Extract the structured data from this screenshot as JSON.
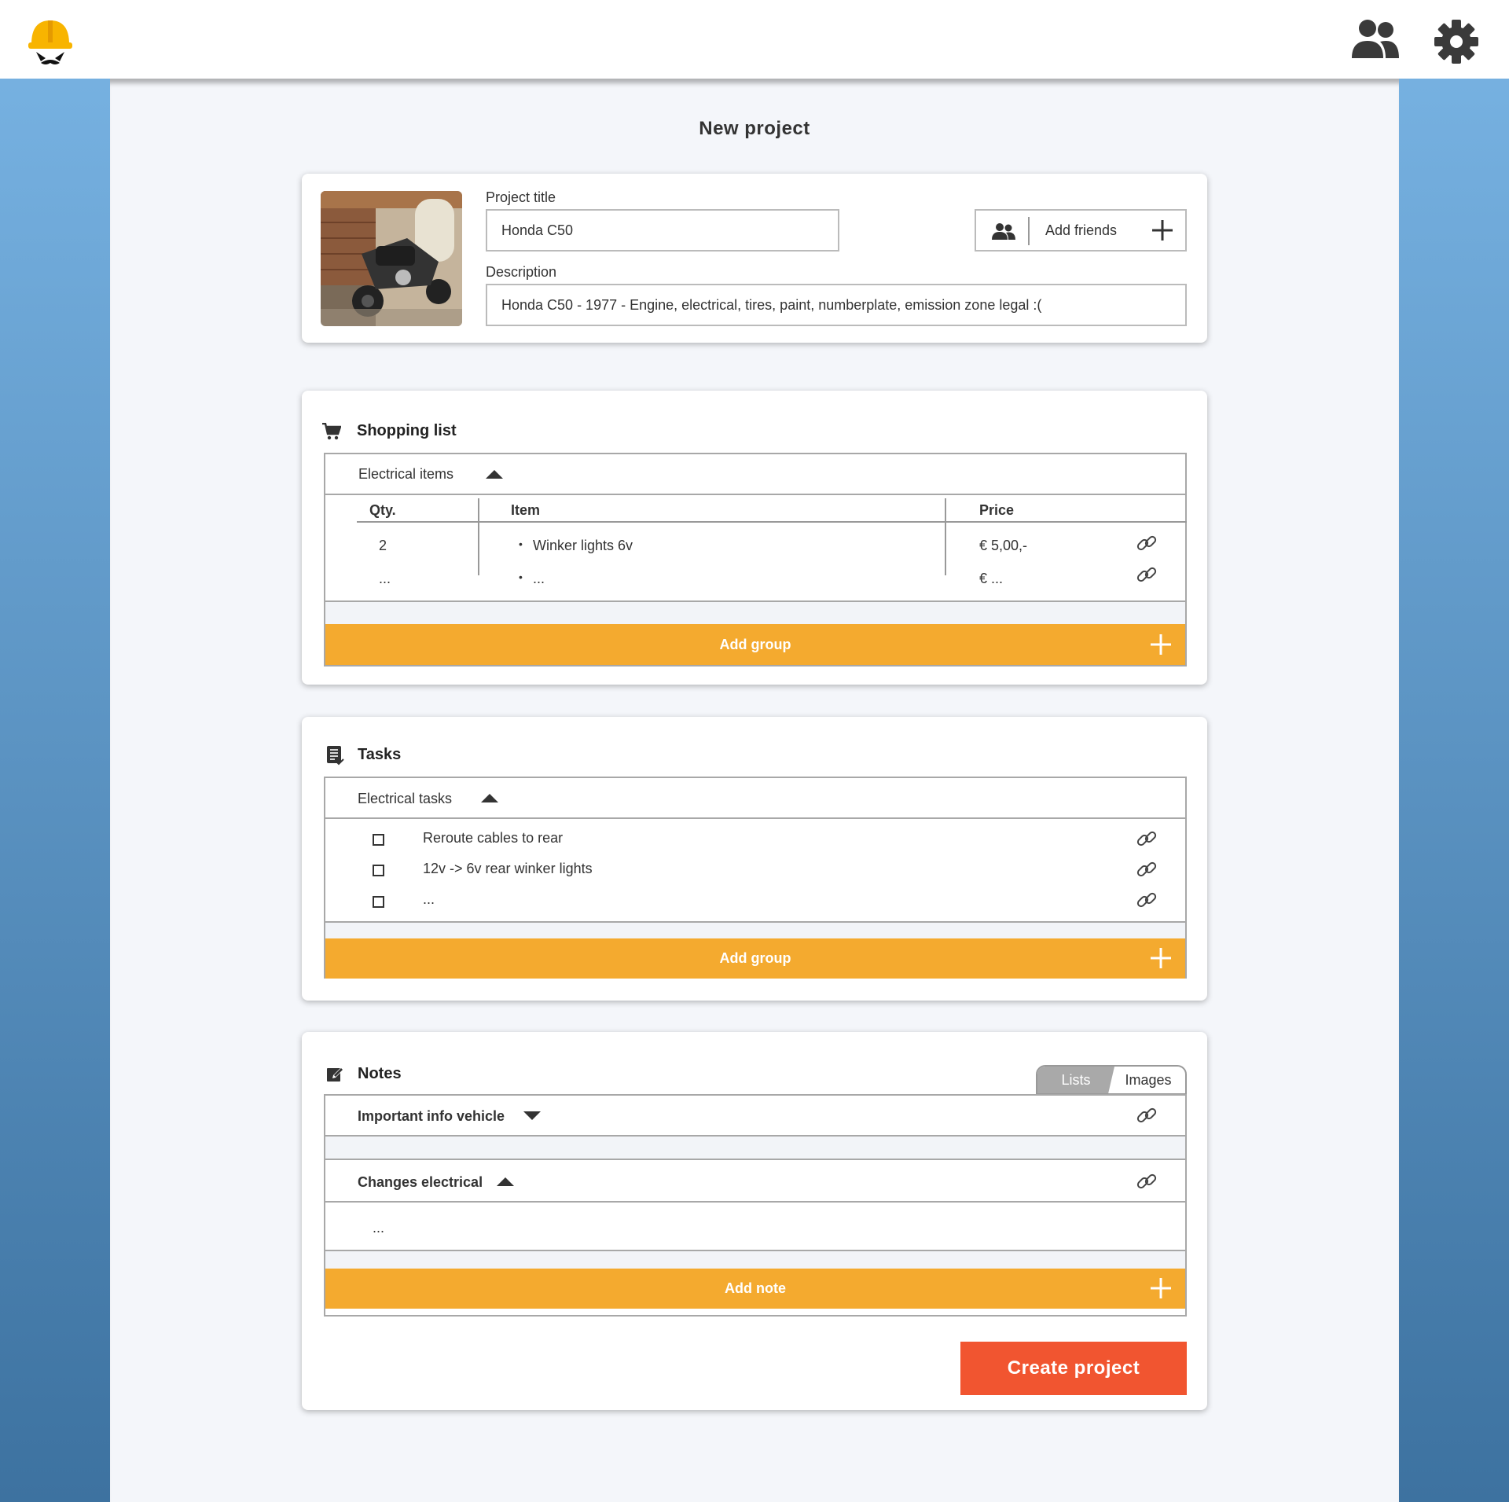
{
  "header": {
    "logo_icon": "construction-helmet-mustache-logo",
    "friends_icon": "users-icon",
    "settings_icon": "gear-icon"
  },
  "page": {
    "title": "New project"
  },
  "project": {
    "image_alt": "motorcycle-photo",
    "title_label": "Project title",
    "title_value": "Honda C50",
    "description_label": "Description",
    "description_value": "Honda C50 - 1977 - Engine, electrical, tires, paint, numberplate, emission zone legal :(",
    "add_friends_label": "Add friends"
  },
  "shopping": {
    "title": "Shopping list",
    "group_label": "Electrical items",
    "columns": {
      "qty": "Qty.",
      "item": "Item",
      "price": "Price"
    },
    "rows": [
      {
        "qty": "2",
        "bullet": "•",
        "item": "Winker lights 6v",
        "price": "€ 5,00,-"
      },
      {
        "qty": "...",
        "bullet": "•",
        "item": "...",
        "price": "€ ..."
      }
    ],
    "add_group_label": "Add group"
  },
  "tasks": {
    "title": "Tasks",
    "group_label": "Electrical tasks",
    "items": [
      {
        "label": "Reroute cables to rear"
      },
      {
        "label": "12v -> 6v rear winker lights"
      },
      {
        "label": "..."
      }
    ],
    "add_group_label": "Add group"
  },
  "notes": {
    "title": "Notes",
    "toggle": {
      "lists": "Lists",
      "images": "Images",
      "active": "Lists"
    },
    "groups": [
      {
        "label": "Important info vehicle",
        "state": "collapsed"
      },
      {
        "label": "Changes electrical",
        "state": "expanded",
        "content": "..."
      }
    ],
    "add_note_label": "Add note"
  },
  "actions": {
    "create_label": "Create project"
  },
  "colors": {
    "accent_orange": "#f4aa2f",
    "create_red": "#f15530",
    "helmet_yellow": "#f8b400",
    "background_blue": "#79b4e4"
  }
}
